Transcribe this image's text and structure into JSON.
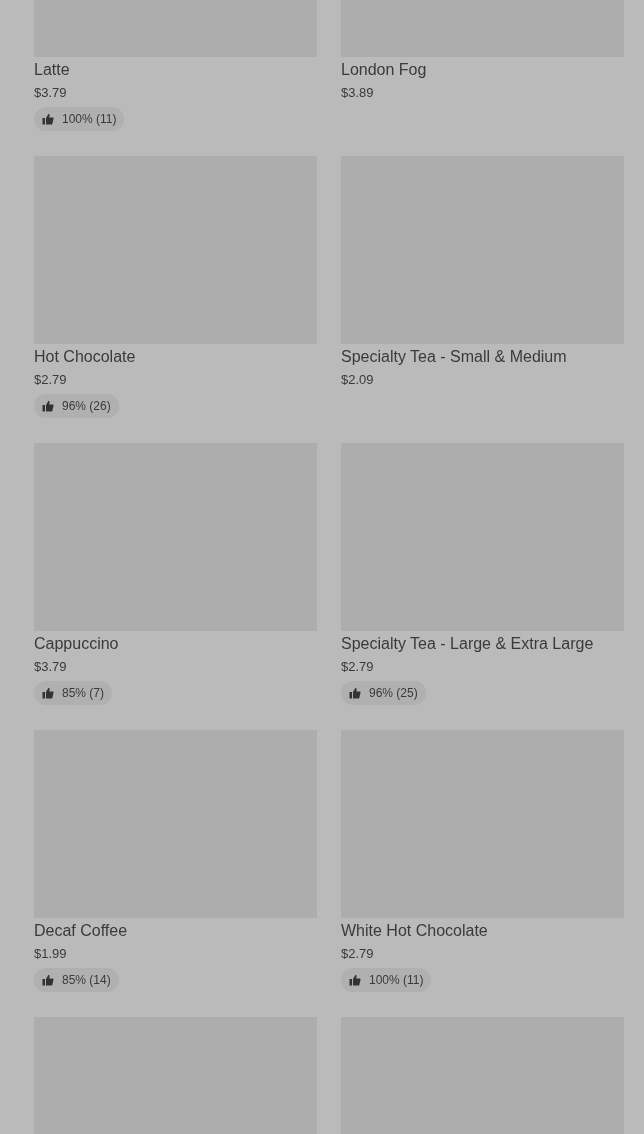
{
  "items": [
    {
      "kind": "product",
      "name": "Latte",
      "price": "$3.79",
      "rating": "100% (11)"
    },
    {
      "kind": "product",
      "name": "London Fog",
      "price": "$3.89"
    },
    {
      "kind": "product",
      "name": "Hot Chocolate",
      "price": "$2.79",
      "rating": "96% (26)"
    },
    {
      "kind": "product",
      "name": "Specialty Tea - Small & Medium",
      "price": "$2.09"
    },
    {
      "kind": "product",
      "name": "Cappuccino",
      "price": "$3.79",
      "rating": "85% (7)"
    },
    {
      "kind": "product",
      "name": "Specialty Tea - Large & Extra Large",
      "price": "$2.79",
      "rating": "96% (25)"
    },
    {
      "kind": "product",
      "name": "Decaf Coffee",
      "price": "$1.99",
      "rating": "85% (14)"
    },
    {
      "kind": "product",
      "name": "White Hot Chocolate",
      "price": "$2.79",
      "rating": "100% (11)"
    },
    {
      "kind": "image_only"
    },
    {
      "kind": "image_only"
    }
  ]
}
